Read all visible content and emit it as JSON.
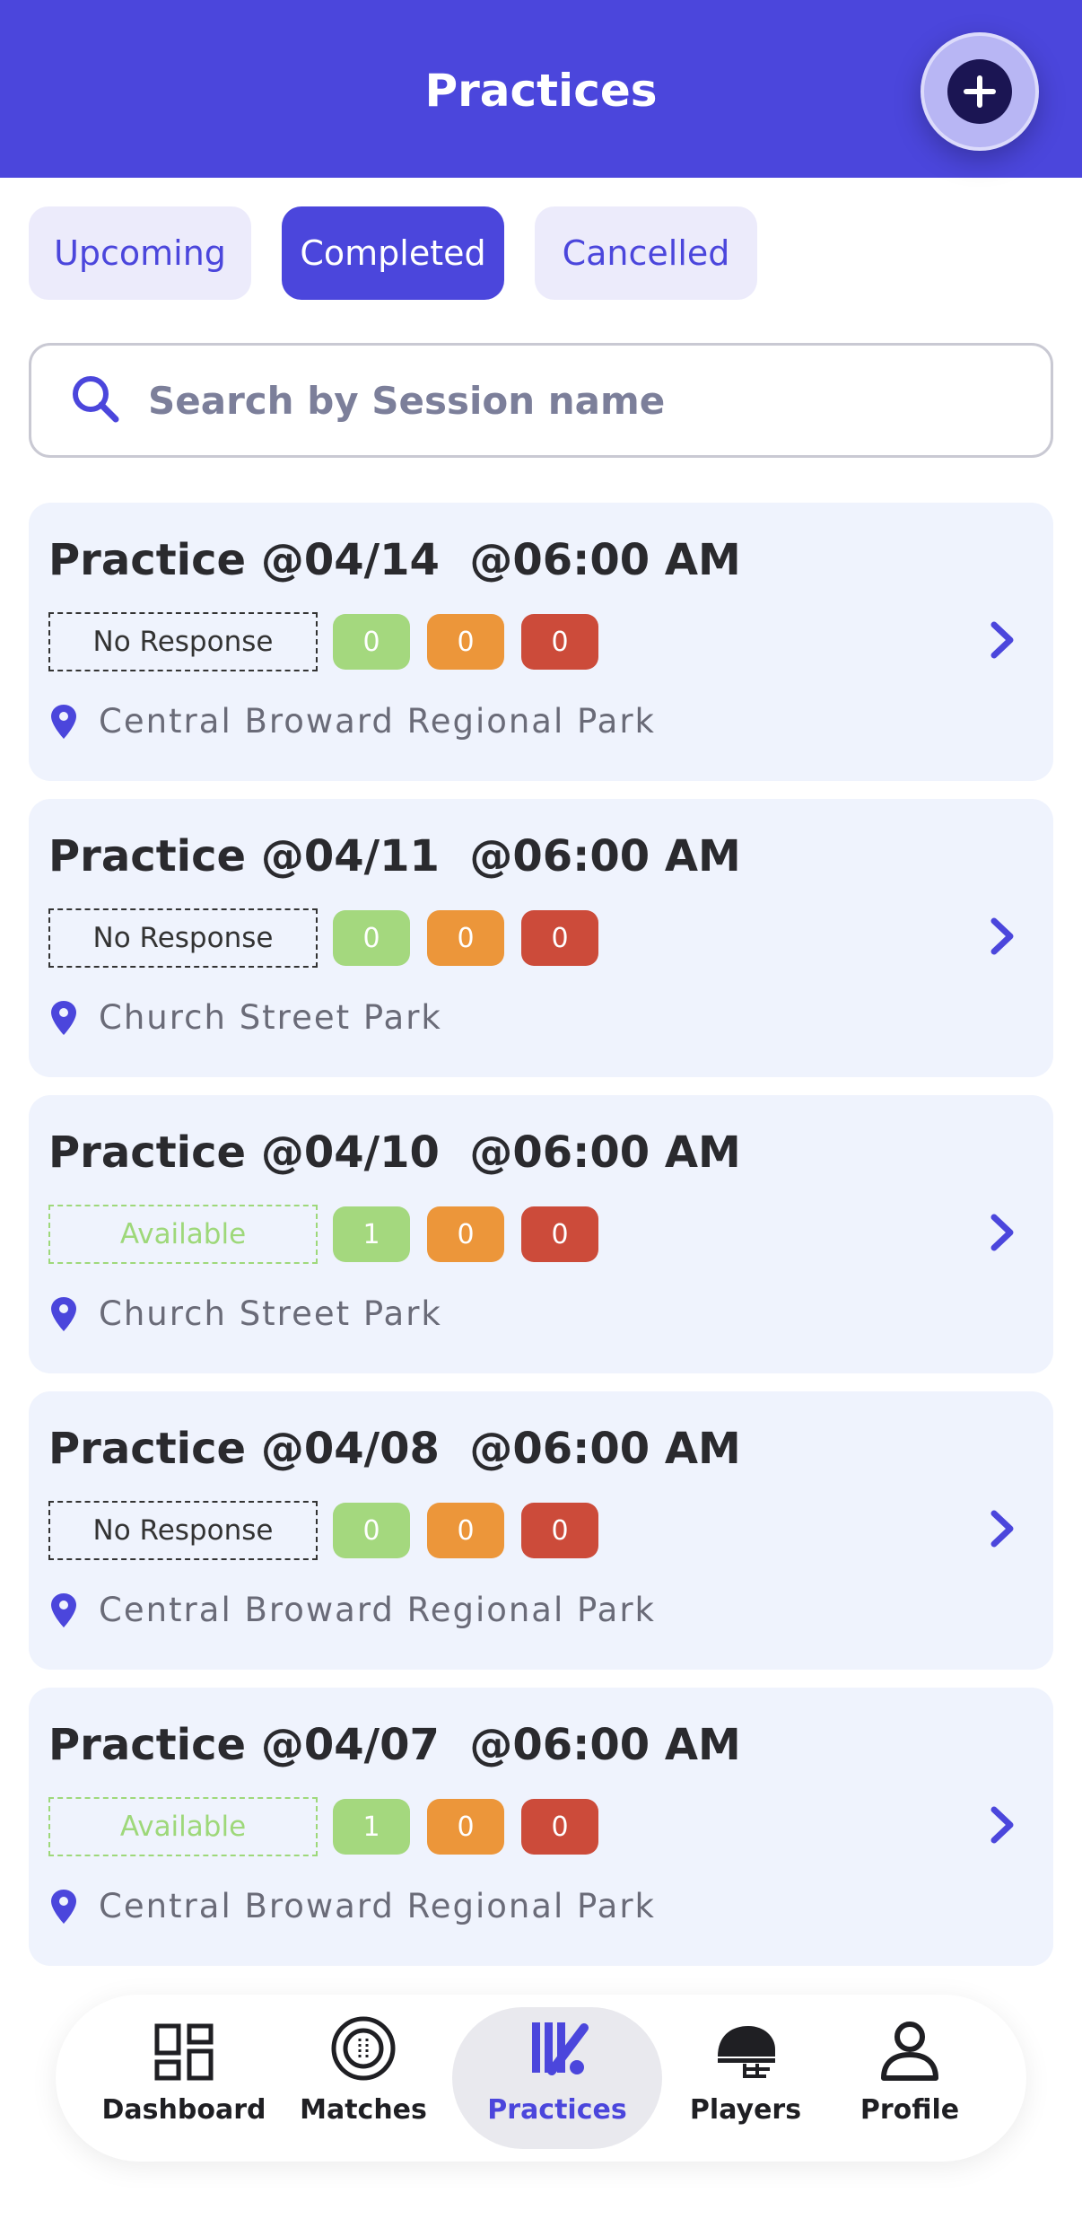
{
  "header": {
    "title": "Practices"
  },
  "tabs": [
    {
      "label": "Upcoming",
      "active": false
    },
    {
      "label": "Completed",
      "active": true
    },
    {
      "label": "Cancelled",
      "active": false
    }
  ],
  "search": {
    "placeholder": "Search by Session name"
  },
  "practices": [
    {
      "title": "Practice @04/14  @06:00 AM",
      "status": "No Response",
      "counts": [
        "0",
        "0",
        "0"
      ],
      "location": "Central Broward Regional Park"
    },
    {
      "title": "Practice @04/11  @06:00 AM",
      "status": "No Response",
      "counts": [
        "0",
        "0",
        "0"
      ],
      "location": "Church Street Park"
    },
    {
      "title": "Practice @04/10  @06:00 AM",
      "status": "Available",
      "counts": [
        "1",
        "0",
        "0"
      ],
      "location": "Church Street Park"
    },
    {
      "title": "Practice @04/08  @06:00 AM",
      "status": "No Response",
      "counts": [
        "0",
        "0",
        "0"
      ],
      "location": "Central Broward Regional Park"
    },
    {
      "title": "Practice @04/07  @06:00 AM",
      "status": "Available",
      "counts": [
        "1",
        "0",
        "0"
      ],
      "location": "Central Broward Regional Park"
    }
  ],
  "nav": [
    {
      "label": "Dashboard",
      "icon": "dashboard-icon",
      "active": false
    },
    {
      "label": "Matches",
      "icon": "cricket-ball-icon",
      "active": false
    },
    {
      "label": "Practices",
      "icon": "cricket-bat-icon",
      "active": true
    },
    {
      "label": "Players",
      "icon": "helmet-icon",
      "active": false
    },
    {
      "label": "Profile",
      "icon": "person-icon",
      "active": false
    }
  ],
  "colors": {
    "primary": "#4b46dc",
    "available": "#9ed87a",
    "count_green": "#a4d87e",
    "count_orange": "#ec963a",
    "count_red": "#cc4b3a"
  }
}
